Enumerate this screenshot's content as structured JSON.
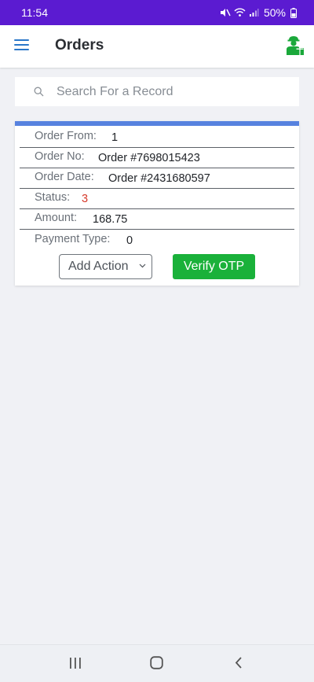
{
  "status_bar": {
    "time": "11:54",
    "battery": "50%",
    "icons": [
      "mute-icon",
      "wifi-icon",
      "signal-icon",
      "battery-icon"
    ]
  },
  "app_bar": {
    "title": "Orders",
    "menu_icon": "hamburger-menu-icon",
    "profile_icon": "delivery-person-icon"
  },
  "search": {
    "placeholder": "Search For a Record",
    "value": ""
  },
  "order_card": {
    "fields": [
      {
        "label": "Order From:",
        "value": "1"
      },
      {
        "label": "Order No:",
        "value": "Order #7698015423"
      },
      {
        "label": "Order Date:",
        "value": "Order #2431680597"
      },
      {
        "label": "Status:",
        "value": "3"
      },
      {
        "label": "Amount:",
        "value": "168.75"
      },
      {
        "label": "Payment Type:",
        "value": "0"
      }
    ],
    "action_select_label": "Add Action",
    "verify_button_label": "Verify OTP"
  },
  "colors": {
    "status_bar": "#5b1bd1",
    "accent_blue": "#2a77c9",
    "card_top": "#5782df",
    "verify_green": "#1ab13a",
    "status_red": "#d63a2b"
  }
}
